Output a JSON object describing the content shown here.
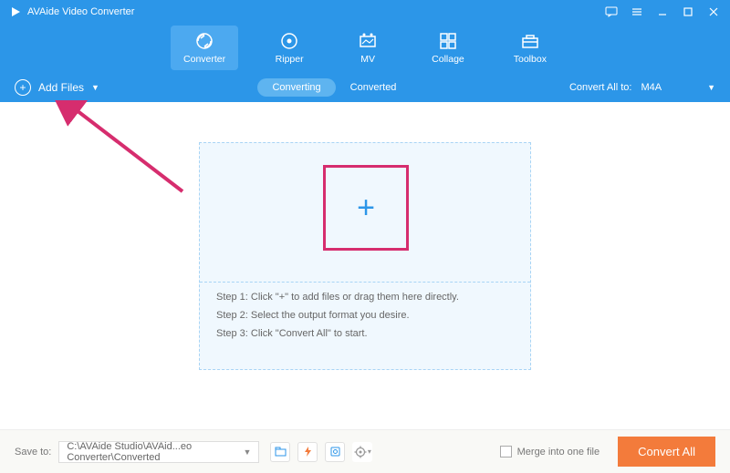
{
  "app": {
    "title": "AVAide Video Converter"
  },
  "tabs": {
    "converter": "Converter",
    "ripper": "Ripper",
    "mv": "MV",
    "collage": "Collage",
    "toolbox": "Toolbox"
  },
  "subbar": {
    "add_files": "Add Files",
    "converting": "Converting",
    "converted": "Converted",
    "convert_all_to": "Convert All to:",
    "format": "M4A"
  },
  "steps": {
    "s1": "Step 1: Click \"+\" to add files or drag them here directly.",
    "s2": "Step 2: Select the output format you desire.",
    "s3": "Step 3: Click \"Convert All\" to start."
  },
  "bottom": {
    "save_to": "Save to:",
    "path": "C:\\AVAide Studio\\AVAid...eo Converter\\Converted",
    "merge": "Merge into one file",
    "convert_all": "Convert All"
  }
}
